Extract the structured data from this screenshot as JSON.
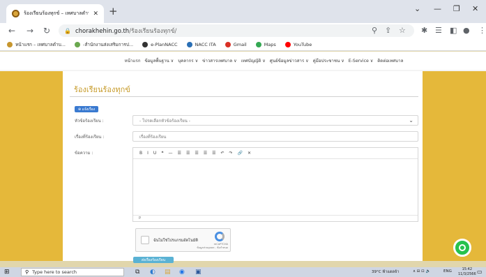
{
  "browser": {
    "tab_title": "ร้องเรียนร้องทุกข์ – เทศบาลตำบลจรเข้หิน",
    "tab_close": "✕",
    "new_tab": "+",
    "url_domain": "chorakhehin.go.th",
    "url_path": "/ร้องเรียนร้องทุกข์/",
    "bookmarks": [
      {
        "label": "หน้าแรก – เทศบาลตำบ...",
        "color": "#c7962e"
      },
      {
        "label": "-สำนักงานส่งเสริมการป...",
        "color": "#6aa84f"
      },
      {
        "label": "e-PlanNACC",
        "color": "#333333"
      },
      {
        "label": "NACC ITA",
        "color": "#2a6fb5"
      },
      {
        "label": "Gmail",
        "color": "#d93025"
      },
      {
        "label": "Maps",
        "color": "#34a853"
      },
      {
        "label": "YouTube",
        "color": "#ff0000"
      }
    ]
  },
  "site_nav": [
    "หน้าแรก",
    "ข้อมูลพื้นฐาน ∨",
    "บุคลากร ∨",
    "ข่าวสารเทศบาล ∨",
    "เทศบัญญัติ ∨",
    "ศูนย์ข้อมูลข่าวสาร ∨",
    "คู่มือประชาชน ∨",
    "E-Service ∨",
    "ติดต่อเทศบาล"
  ],
  "form": {
    "title": "ร้องเรียนร้องทุกข์",
    "badge": "⊕ แจ้งเรื่อง",
    "topic_label": "หัวข้อร้องเรียน :",
    "topic_value": "- โปรดเลือกหัวข้อร้องเรียน -",
    "subject_label": "เรื่องที่ร้องเรียน :",
    "subject_placeholder": "เรื่องที่ร้องเรียน",
    "message_label": "ข้อความ :",
    "editor_tools": [
      "B",
      "I",
      "U",
      "❝",
      "—",
      "☰",
      "☰",
      "☰",
      "☰",
      "☰",
      "↶",
      "↷",
      "🔗",
      "✕"
    ],
    "editor_status": "p",
    "captcha_text": "ฉันไม่ใช่โปรแกรมอัตโนมัติ",
    "captcha_brand": "reCAPTCHA",
    "captcha_terms": "ข้อมูลส่วนบุคคล - ข้อกำหนด",
    "submit": "ส่งเรื่องร้องเรียน"
  },
  "taskbar": {
    "search_placeholder": "Type here to search",
    "weather": "39°C",
    "weather_desc": "ฟ้าแดดจ้า",
    "lang": "ENG",
    "time": "15:42",
    "date": "11/3/2566"
  },
  "colors": {
    "gold": "#e5b83a",
    "title": "#c79b2a",
    "badge": "#3a7ad0",
    "submit": "#5ab2d4",
    "line": "#27c24c"
  }
}
